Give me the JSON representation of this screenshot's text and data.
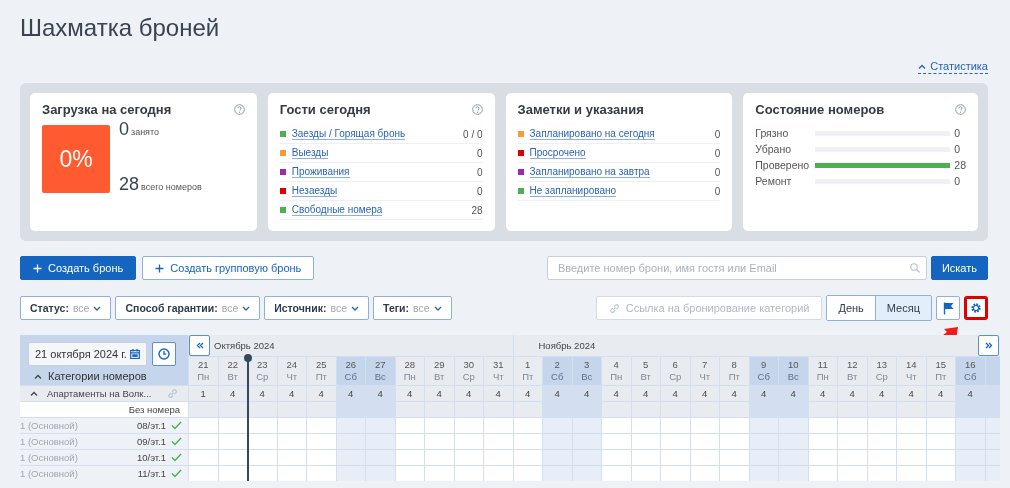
{
  "page_title": "Шахматка броней",
  "stats_link": "Статистика",
  "cards": [
    {
      "kind": "load",
      "title": "Загрузка на сегодня",
      "help": true,
      "percent": "0%",
      "occupied": "0",
      "occupied_label": "занято",
      "total": "28",
      "total_label": "всего номеров"
    },
    {
      "kind": "list",
      "title": "Гости сегодня",
      "help": true,
      "items": [
        {
          "label": "Заезды / Горящая бронь",
          "value": "0 / 0",
          "color": "#4caf50"
        },
        {
          "label": "Выезды",
          "value": "0",
          "color": "#ff9933"
        },
        {
          "label": "Проживания",
          "value": "0",
          "color": "#9c27b0"
        },
        {
          "label": "Незаезды",
          "value": "0",
          "color": "#e00000"
        },
        {
          "label": "Свободные номера",
          "value": "28",
          "color": "#4caf50"
        }
      ]
    },
    {
      "kind": "list",
      "title": "Заметки и указания",
      "help": false,
      "items": [
        {
          "label": "Запланировано на сегодня",
          "value": "0",
          "color": "#ff9933"
        },
        {
          "label": "Просрочено",
          "value": "0",
          "color": "#e00000"
        },
        {
          "label": "Запланировано на завтра",
          "value": "0",
          "color": "#9c27b0"
        },
        {
          "label": "Не запланировано",
          "value": "0",
          "color": "#4caf50"
        }
      ]
    },
    {
      "kind": "bars",
      "title": "Состояние номеров",
      "help": true,
      "items": [
        {
          "label": "Грязно",
          "value": "0",
          "level": 0
        },
        {
          "label": "Убрано",
          "value": "0",
          "level": 0
        },
        {
          "label": "Проверено",
          "value": "28",
          "level": 1
        },
        {
          "label": "Ремонт",
          "value": "0",
          "level": 0
        }
      ]
    }
  ],
  "create_button": "Создать бронь",
  "group_button": "Создать групповую бронь",
  "search": {
    "placeholder": "Введите номер брони, имя гостя или Email"
  },
  "search_button": "Искать",
  "filters": [
    {
      "label": "Статус:",
      "value": "все"
    },
    {
      "label": "Способ гарантии:",
      "value": "все"
    },
    {
      "label": "Источник:",
      "value": "все"
    },
    {
      "label": "Теги:",
      "value": "все"
    }
  ],
  "link_button": {
    "label": "Ссылка на бронирование категорий",
    "disabled": true
  },
  "view_tabs": [
    {
      "label": "День",
      "selected": false
    },
    {
      "label": "Месяц",
      "selected": true
    }
  ],
  "tool_buttons": [
    {
      "kind": "flag",
      "highlighted": false
    },
    {
      "kind": "settings",
      "highlighted": true
    }
  ],
  "grid": {
    "date": "21 октября 2024 г.",
    "categories_label": "Категории номеров",
    "categories_expanded": true,
    "months": [
      {
        "label": "Октябрь 2024",
        "days": [
          {
            "day": "21",
            "weekday": "Пн",
            "count": "1",
            "weekend": false,
            "now": false
          },
          {
            "day": "22",
            "weekday": "Вт",
            "count": "4",
            "weekend": false,
            "now": false
          },
          {
            "day": "23",
            "weekday": "Ср",
            "count": "4",
            "weekend": false,
            "now": true
          },
          {
            "day": "24",
            "weekday": "Чт",
            "count": "4",
            "weekend": false,
            "now": false
          },
          {
            "day": "25",
            "weekday": "Пт",
            "count": "4",
            "weekend": false,
            "now": false
          },
          {
            "day": "26",
            "weekday": "Сб",
            "count": "4",
            "weekend": true,
            "now": false
          },
          {
            "day": "27",
            "weekday": "Вс",
            "count": "4",
            "weekend": true,
            "now": false
          },
          {
            "day": "28",
            "weekday": "Пн",
            "count": "4",
            "weekend": false,
            "now": false
          },
          {
            "day": "29",
            "weekday": "Вт",
            "count": "4",
            "weekend": false,
            "now": false
          },
          {
            "day": "30",
            "weekday": "Ср",
            "count": "4",
            "weekend": false,
            "now": false
          },
          {
            "day": "31",
            "weekday": "Чт",
            "count": "4",
            "weekend": false,
            "now": false
          }
        ]
      },
      {
        "label": "Ноябрь 2024",
        "days": [
          {
            "day": "1",
            "weekday": "Пт",
            "count": "4",
            "weekend": false,
            "now": false
          },
          {
            "day": "2",
            "weekday": "Сб",
            "count": "4",
            "weekend": true,
            "now": false
          },
          {
            "day": "3",
            "weekday": "Вс",
            "count": "4",
            "weekend": true,
            "now": false
          },
          {
            "day": "4",
            "weekday": "Пн",
            "count": "4",
            "weekend": false,
            "now": false
          },
          {
            "day": "5",
            "weekday": "Вт",
            "count": "4",
            "weekend": false,
            "now": false
          },
          {
            "day": "6",
            "weekday": "Ср",
            "count": "4",
            "weekend": false,
            "now": false
          },
          {
            "day": "7",
            "weekday": "Чт",
            "count": "4",
            "weekend": false,
            "now": false
          },
          {
            "day": "8",
            "weekday": "Пт",
            "count": "4",
            "weekend": false,
            "now": false
          },
          {
            "day": "9",
            "weekday": "Сб",
            "count": "4",
            "weekend": true,
            "now": false
          },
          {
            "day": "10",
            "weekday": "Вс",
            "count": "4",
            "weekend": true,
            "now": false
          },
          {
            "day": "11",
            "weekday": "Пн",
            "count": "4",
            "weekend": false,
            "now": false
          },
          {
            "day": "12",
            "weekday": "Вт",
            "count": "4",
            "weekend": false,
            "now": false
          },
          {
            "day": "13",
            "weekday": "Ср",
            "count": "4",
            "weekend": false,
            "now": false
          },
          {
            "day": "14",
            "weekday": "Чт",
            "count": "4",
            "weekend": false,
            "now": false
          },
          {
            "day": "15",
            "weekday": "Пт",
            "count": "4",
            "weekend": false,
            "now": false
          },
          {
            "day": "16",
            "weekday": "Сб",
            "count": "4",
            "weekend": true,
            "now": false
          }
        ]
      }
    ],
    "category": {
      "name": "Апартаменты на Волк...",
      "expanded": true
    },
    "unassigned_label": "Без номера",
    "rooms": [
      {
        "type": "1 (Основной)",
        "number": "08/эт.1",
        "ready": true
      },
      {
        "type": "1 (Основной)",
        "number": "09/эт.1",
        "ready": true
      },
      {
        "type": "1 (Основной)",
        "number": "10/эт.1",
        "ready": true
      },
      {
        "type": "1 (Основной)",
        "number": "11/эт.1",
        "ready": true
      }
    ]
  }
}
